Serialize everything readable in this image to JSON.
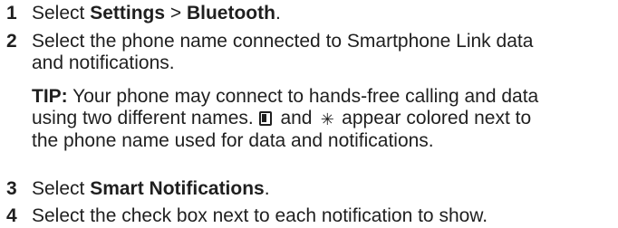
{
  "steps": [
    {
      "number": "1",
      "prefix": "Select ",
      "bold1": "Settings",
      "middle": " > ",
      "bold2": "Bluetooth",
      "suffix": "."
    },
    {
      "number": "2",
      "line1": "Select the phone name connected to Smartphone Link data",
      "line2": "and notifications."
    },
    {
      "number": "3",
      "prefix": "Select ",
      "bold": "Smart Notifications",
      "suffix": "."
    },
    {
      "number": "4",
      "text": "Select the check box next to each notification to show."
    }
  ],
  "tip": {
    "label": "TIP:",
    "line1": " Your phone may connect to hands-free calling and data",
    "line2": "using two different names.",
    "and": " and ",
    "line2_tail": " appear colored next to",
    "line3": "the phone name used for data and notifications."
  },
  "icons": {
    "first": "phone-icon",
    "second": "bluetooth-sparkle-icon"
  }
}
